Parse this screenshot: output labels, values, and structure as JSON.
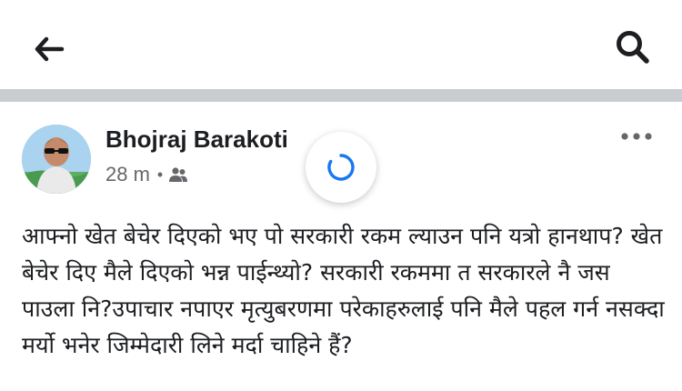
{
  "header": {
    "back_icon": "arrow-left-icon",
    "search_icon": "search-icon"
  },
  "post": {
    "author": "Bhojraj Barakoti",
    "time": "28 m",
    "separator": "•",
    "audience_icon": "friends-icon",
    "more_icon": "more-horizontal-icon",
    "loading_icon": "loading-spinner-icon",
    "text": "आफ्नो खेत बेचेर दिएको भए पो सरकारी रकम ल्याउन पनि यत्रो हानथाप? खेत बेचेर दिए मैले दिएको भन्न पाईन्थ्यो? सरकारी रकममा त सरकारले नै जस पाउला नि?उपाचार नपाएर मृत्युबरणमा परेकाहरुलाई पनि मैले पहल गर्न नसक्दा मर्यो भनेर जिम्मेदारी लिने मर्दा चाहिने हैं?"
  },
  "colors": {
    "divider": "#c9ccd1",
    "meta_text": "#65676b",
    "spinner": "#1877f2",
    "text": "#1c1e21"
  }
}
